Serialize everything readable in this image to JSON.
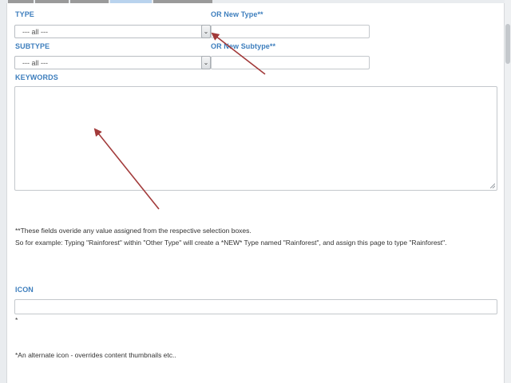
{
  "tabs": [
    {
      "label": "",
      "color": "#9a9a9a"
    },
    {
      "label": "",
      "color": "#9a9a9a"
    },
    {
      "label": "",
      "color": "#9a9a9a"
    },
    {
      "label": "",
      "color": "#b9d3ee"
    },
    {
      "label": "",
      "color": "#9a9a9a"
    }
  ],
  "form": {
    "type_label": "TYPE",
    "type_select_value": "--- all ---",
    "new_type_label": "OR New Type**",
    "new_type_value": "",
    "subtype_label": "SUBTYPE",
    "subtype_select_value": "--- all ---",
    "new_subtype_label": "OR New Subtype**",
    "new_subtype_value": "",
    "keywords_label": "KEYWORDS",
    "keywords_value": "",
    "note_line1": "**These fields overide any value assigned from the respective selection boxes.",
    "note_line2": "So for example: Typing \"Rainforest\" within \"Other Type\" will create a *NEW* Type named \"Rainforest\", and assign this page to type \"Rainforest\".",
    "icon_label": "ICON",
    "icon_value": "",
    "icon_asterisk": "*",
    "icon_note": "*An alternate icon - overrides content thumbnails etc.."
  },
  "colors": {
    "label_blue": "#3d7ebd",
    "arrow_red": "#a23a3a"
  },
  "icons": {
    "dropdown": "chevron-down-icon",
    "arrows": "red-annotation-arrow-icon"
  }
}
